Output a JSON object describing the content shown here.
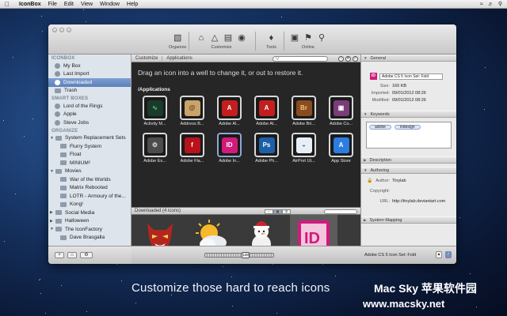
{
  "menubar": {
    "app_name": "IconBox",
    "items": [
      "File",
      "Edit",
      "View",
      "Window",
      "Help"
    ],
    "status_time": "•"
  },
  "toolbar": {
    "groups": [
      {
        "label": "Organize",
        "icons": [
          "drive-icon"
        ]
      },
      {
        "label": "Customize",
        "icons": [
          "house-icon",
          "pencil-icon",
          "window-icon",
          "globe-icon"
        ]
      },
      {
        "label": "Tools",
        "icons": [
          "compass-icon"
        ]
      },
      {
        "label": "Online",
        "icons": [
          "camera-icon",
          "bookmark-icon",
          "magnifier-icon"
        ]
      }
    ]
  },
  "sidebar": {
    "sections": [
      {
        "title": "ICONBOX",
        "items": [
          {
            "label": "My Box",
            "kind": "dot"
          },
          {
            "label": "Last Import",
            "kind": "dot"
          },
          {
            "label": "Downloaded",
            "kind": "dot",
            "selected": true
          },
          {
            "label": "Trash",
            "kind": "folder"
          }
        ]
      },
      {
        "title": "SMART BOXES",
        "items": [
          {
            "label": "Lord of the Rings",
            "kind": "dot"
          },
          {
            "label": "Apple",
            "kind": "dot"
          },
          {
            "label": "Steve Jobs",
            "kind": "dot"
          }
        ]
      },
      {
        "title": "ORGANIZE",
        "items": [
          {
            "label": "System Replacement Sets",
            "kind": "folder",
            "expanded": true
          },
          {
            "label": "Flurry System",
            "kind": "folder",
            "child": true
          },
          {
            "label": "Float",
            "kind": "folder",
            "child": true
          },
          {
            "label": "MINIUM²",
            "kind": "folder",
            "child": true
          },
          {
            "label": "Movies",
            "kind": "folder",
            "expanded": true
          },
          {
            "label": "War of the Worlds",
            "kind": "folder",
            "child": true
          },
          {
            "label": "Matrix Rebooted",
            "kind": "folder",
            "child": true
          },
          {
            "label": "LOTR - Armoury of the...",
            "kind": "folder",
            "child": true
          },
          {
            "label": "Kong!",
            "kind": "folder",
            "child": true
          },
          {
            "label": "Social Media",
            "kind": "folder",
            "collapsed": true
          },
          {
            "label": "Halloween",
            "kind": "folder",
            "collapsed": true
          },
          {
            "label": "The IconFactory",
            "kind": "folder",
            "expanded": true
          },
          {
            "label": "Dave Brasgalla",
            "kind": "folder",
            "child": true
          }
        ]
      }
    ],
    "bottom_buttons": [
      "+",
      "⌂",
      "⚙"
    ]
  },
  "pathbar": {
    "crumbs": [
      "Customize",
      "Applications"
    ],
    "search_placeholder": "Q",
    "round_buttons": [
      "○",
      "✕",
      "✓"
    ]
  },
  "main": {
    "drag_hint": "Drag an icon into a well to change it, or out to restore it.",
    "folder_title": "/Applications",
    "icons": [
      {
        "label": "Activity M...",
        "bg": "#1b3a2b",
        "fg": "#54d07c",
        "glyph": "∿"
      },
      {
        "label": "Address B...",
        "bg": "#c8a46a",
        "fg": "#5b3a12",
        "glyph": "@"
      },
      {
        "label": "Adobe Al...",
        "bg": "#c41e1e",
        "fg": "#ffffff",
        "glyph": "A"
      },
      {
        "label": "Adobe Al...",
        "bg": "#c41e1e",
        "fg": "#ffffff",
        "glyph": "A"
      },
      {
        "label": "Adobe Bri...",
        "bg": "#8a4b1e",
        "fg": "#f5c28a",
        "glyph": "Br"
      },
      {
        "label": "Adobe Co...",
        "bg": "#7a3d78",
        "fg": "#ffffff",
        "glyph": "▣"
      },
      {
        "label": "Adobe Ex...",
        "bg": "#4c4c4c",
        "fg": "#dcdcdc",
        "glyph": "⚙"
      },
      {
        "label": "Adobe Fla...",
        "bg": "#b8121a",
        "fg": "#ffffff",
        "glyph": "f"
      },
      {
        "label": "Adobe In...",
        "bg": "#d11b7b",
        "fg": "#ffffff",
        "glyph": "ID",
        "highlight": true
      },
      {
        "label": "Adobe Ph...",
        "bg": "#1d5fa8",
        "fg": "#ffffff",
        "glyph": "Ps"
      },
      {
        "label": "AirPort Ut...",
        "bg": "#e9eef4",
        "fg": "#2c72c9",
        "glyph": "◒"
      },
      {
        "label": "App Store",
        "bg": "#2b7de0",
        "fg": "#ffffff",
        "glyph": "A"
      }
    ],
    "downloads_label": "Downloaded (4 icons)",
    "downloaded_icons": [
      "devil-mask-icon",
      "sun-cloud-icon",
      "snowman-icon",
      "indesign-icon"
    ]
  },
  "inspector": {
    "general_title": "General",
    "name_value": "Adobe CS 5 Icon Set: Fold",
    "size_label": "Size:",
    "size_value": "160 KB",
    "imported_label": "Imported:",
    "imported_value": "09/01/2012 08:26",
    "modified_label": "Modified:",
    "modified_value": "09/01/2012 08:26",
    "keywords_title": "Keywords",
    "keywords": [
      "adobe",
      "indesign"
    ],
    "description_title": "Description",
    "authoring_title": "Authoring",
    "author_label": "Author:",
    "author_value": "Tinylab",
    "copyright_label": "Copyright:",
    "url_label": "URL:",
    "url_value": "http://tinylab.deviantart.com",
    "mapping_title": "System Mapping"
  },
  "statusbar": {
    "zoom_value": "128",
    "selected_name": "Adobe CS 5 Icon Set: Fold"
  },
  "caption": "Customize those hard to reach icons",
  "watermark": {
    "line1": "Mac Sky 苹果软件园",
    "line2": "www.macsky.net"
  },
  "colors": {
    "selection": "#5c80bc",
    "indesign": "#d11b7b",
    "desktop": "#15315f"
  }
}
